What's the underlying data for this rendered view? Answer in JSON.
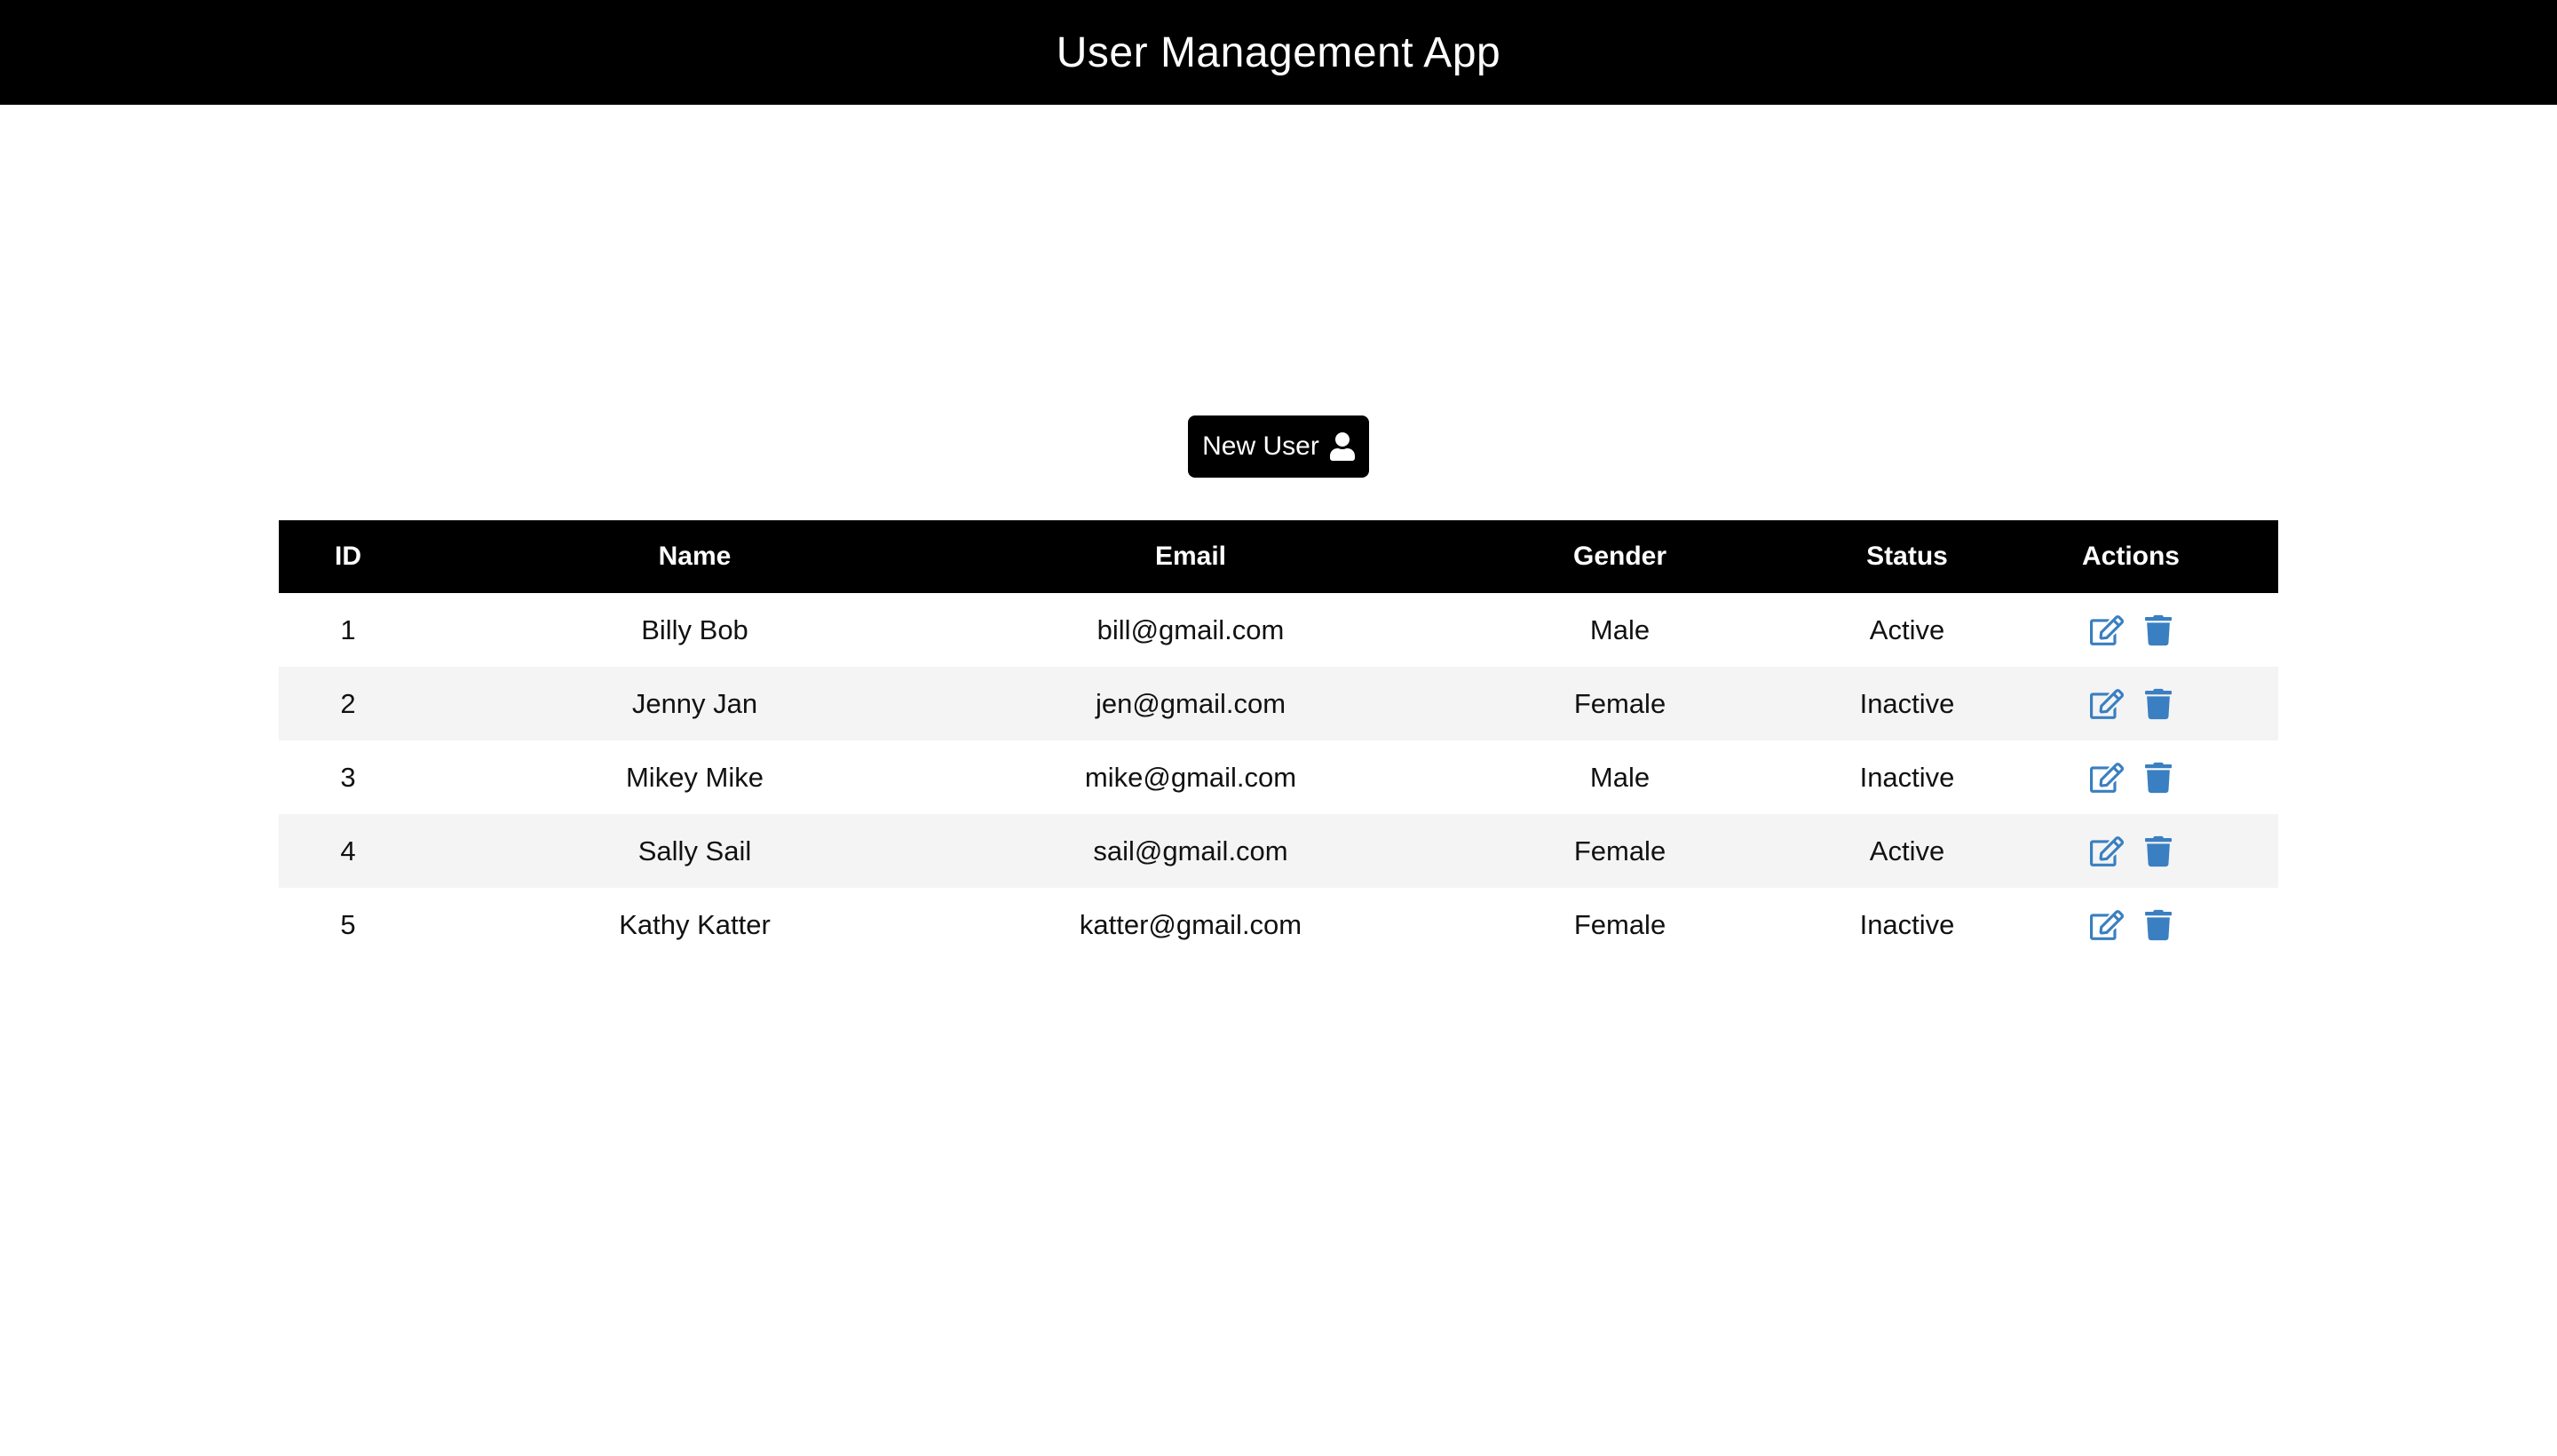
{
  "header": {
    "title": "User Management App"
  },
  "toolbar": {
    "new_user_label": "New User",
    "new_user_icon": "user-icon"
  },
  "table": {
    "columns": [
      "ID",
      "Name",
      "Email",
      "Gender",
      "Status",
      "Actions"
    ],
    "rows": [
      {
        "id": "1",
        "name": "Billy Bob",
        "email": "bill@gmail.com",
        "gender": "Male",
        "status": "Active"
      },
      {
        "id": "2",
        "name": "Jenny Jan",
        "email": "jen@gmail.com",
        "gender": "Female",
        "status": "Inactive"
      },
      {
        "id": "3",
        "name": "Mikey Mike",
        "email": "mike@gmail.com",
        "gender": "Male",
        "status": "Inactive"
      },
      {
        "id": "4",
        "name": "Sally Sail",
        "email": "sail@gmail.com",
        "gender": "Female",
        "status": "Active"
      },
      {
        "id": "5",
        "name": "Kathy Katter",
        "email": "katter@gmail.com",
        "gender": "Female",
        "status": "Inactive"
      }
    ],
    "row_actions": [
      "edit-icon",
      "trash-icon"
    ]
  },
  "colors": {
    "header_bg": "#000000",
    "accent_icon": "#3a7fc1",
    "stripe": "#f4f4f4"
  }
}
